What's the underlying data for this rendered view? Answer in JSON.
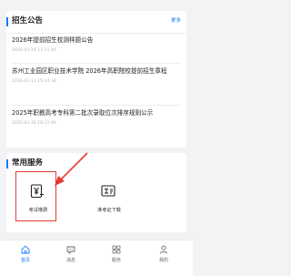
{
  "notices": {
    "title": "招生公告",
    "more": "更多",
    "items": [
      {
        "title": "2026年提前招生校测样题公告",
        "date": "2026-03-16 11:21:44"
      },
      {
        "title": "苏州工业园区职业技术学院 2026年高职院校提前招生章程",
        "date": "2026-03-11 15:34:34"
      },
      {
        "title": "2025年职教高考专科第二批次录取位次排序规则公示",
        "date": "2025-04-30 18:11:09"
      }
    ]
  },
  "services": {
    "title": "常用服务",
    "items": [
      {
        "label": "考试缴费",
        "icon": "payment-yen-icon",
        "highlighted": true
      },
      {
        "label": "准考证下载",
        "icon": "admission-ticket-icon",
        "highlighted": false
      }
    ]
  },
  "tabbar": {
    "active": "首页",
    "items": [
      {
        "label": "首页",
        "icon": "home-icon"
      },
      {
        "label": "消息",
        "icon": "message-icon"
      },
      {
        "label": "服务",
        "icon": "grid-icon"
      },
      {
        "label": "我的",
        "icon": "user-icon"
      }
    ]
  },
  "colors": {
    "accent": "#1677ff",
    "annotation": "#e53935",
    "background": "#f2f3f5"
  }
}
